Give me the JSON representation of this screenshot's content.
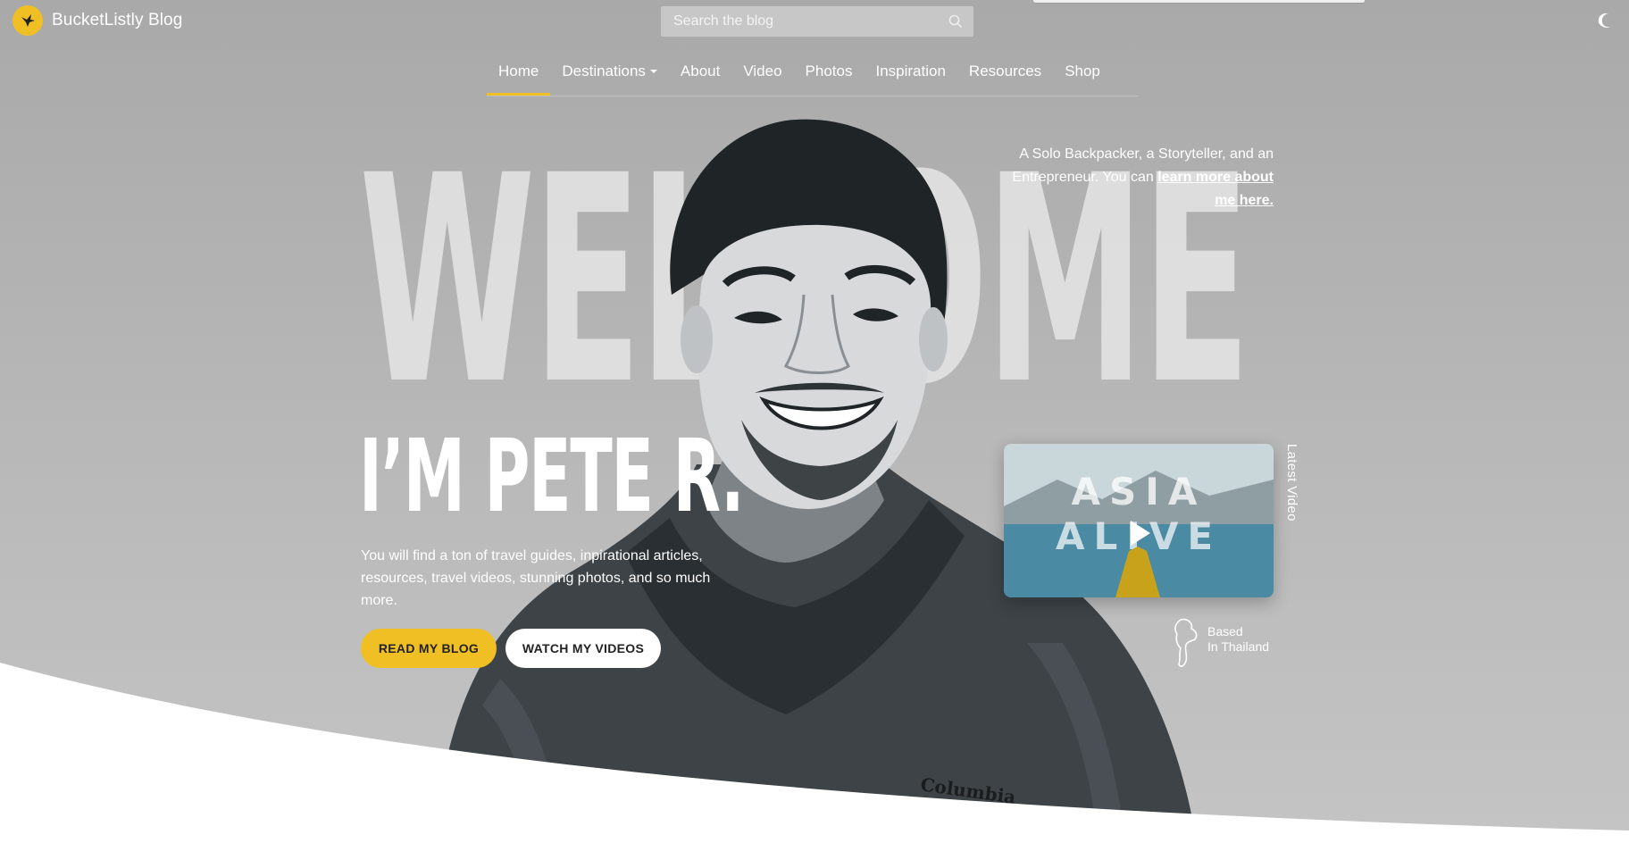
{
  "header": {
    "logo_text": "BucketListly Blog",
    "search_placeholder": "Search the blog"
  },
  "nav": {
    "items": [
      {
        "label": "Home",
        "active": true
      },
      {
        "label": "Destinations",
        "has_caret": true
      },
      {
        "label": "About"
      },
      {
        "label": "Video"
      },
      {
        "label": "Photos"
      },
      {
        "label": "Inspiration"
      },
      {
        "label": "Resources"
      },
      {
        "label": "Shop"
      }
    ]
  },
  "hero": {
    "background_word": "WELCOME",
    "headline": "I’M PETE R.",
    "description": "You will find a ton of travel guides, inpirational articles, resources, travel videos, stunning photos, and so much more.",
    "intro_prefix": "A Solo Backpacker, a Storyteller, and an Entrepreneur. You can ",
    "intro_link": "learn more about me here.",
    "buttons": {
      "read_blog": "READ MY BLOG",
      "watch_videos": "WATCH MY VIDEOS"
    },
    "latest_video_label": "Latest Video",
    "video_thumbnail_text": [
      "ASIA",
      "ALIVE"
    ],
    "based_line1": "Based",
    "based_line2": "In Thailand",
    "jacket_brand": "Columbia"
  },
  "icons": {
    "logo": "bird-icon",
    "search": "search-icon",
    "theme": "moon-icon",
    "play": "play-icon",
    "map": "thailand-map-icon"
  },
  "colors": {
    "accent": "#f0bf24",
    "hero_bg": "#b3b3b3",
    "text": "#ffffff"
  }
}
